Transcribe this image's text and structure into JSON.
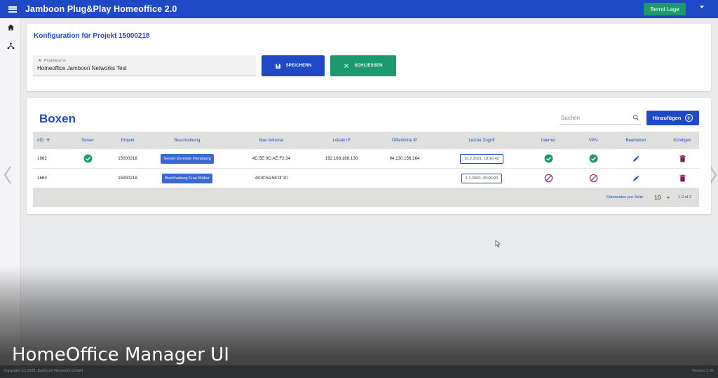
{
  "app": {
    "title": "Jamboon Plug&Play Homeoffice 2.0",
    "user_button": "Bernd Lage"
  },
  "sidebar": {
    "items": [
      {
        "icon": "home-icon"
      },
      {
        "icon": "network-icon"
      }
    ]
  },
  "config": {
    "title": "Konfiguration für Projekt 15000218",
    "field_label": "Projektname",
    "field_value": "Homeoffice Jamboon Networks Test",
    "save_label": "SPEICHERN",
    "close_label": "SCHLIESSEN"
  },
  "boxes": {
    "title": "Boxen",
    "search_placeholder": "Suchen",
    "add_label": "Hinzufügen",
    "columns": {
      "id": "#ID",
      "server": "Server",
      "project": "Projekt",
      "description": "Beschreibung",
      "mac": "Mac Adresse",
      "local_ip": "Lokale IP",
      "public_ip": "Öffentliche IP",
      "last_access": "Letzter Zugriff",
      "internet": "Internet",
      "vpn": "VPN",
      "edit": "Bearbeiten",
      "cancel": "Kündigen"
    },
    "rows": [
      {
        "id": "1662",
        "server": true,
        "project": "15000218",
        "description": "Server Zentrale Flensburg",
        "mac": "4C:5E:0C:AE:F2:34",
        "local_ip": "192.168.188.130",
        "public_ip": "94.130.156.164",
        "last_access": "10.2.2021, 18:16:42",
        "internet": "ok",
        "vpn": "ok"
      },
      {
        "id": "1663",
        "server": false,
        "project": "15000218",
        "description": "Buchhaltung Frau Müller",
        "mac": "48:8f:5a:58:0f:10",
        "local_ip": "",
        "public_ip": "",
        "last_access": "1.1.2000, 00:00:00",
        "internet": "blocked",
        "vpn": "blocked"
      }
    ],
    "pager": {
      "label": "Datensätze pro Seite",
      "page_size": "10",
      "range": "1-2 of 2"
    }
  },
  "colors": {
    "primary": "#1f49c6",
    "success": "#1b9a6d",
    "blocked": "#8e3b8c",
    "delete": "#7a1f5c"
  },
  "caption": "HomeOffice Manager UI",
  "footer": {
    "copyright": "Copyright (c) 2021 Jamboon Networks GmbH",
    "version": "Version 1.02"
  }
}
